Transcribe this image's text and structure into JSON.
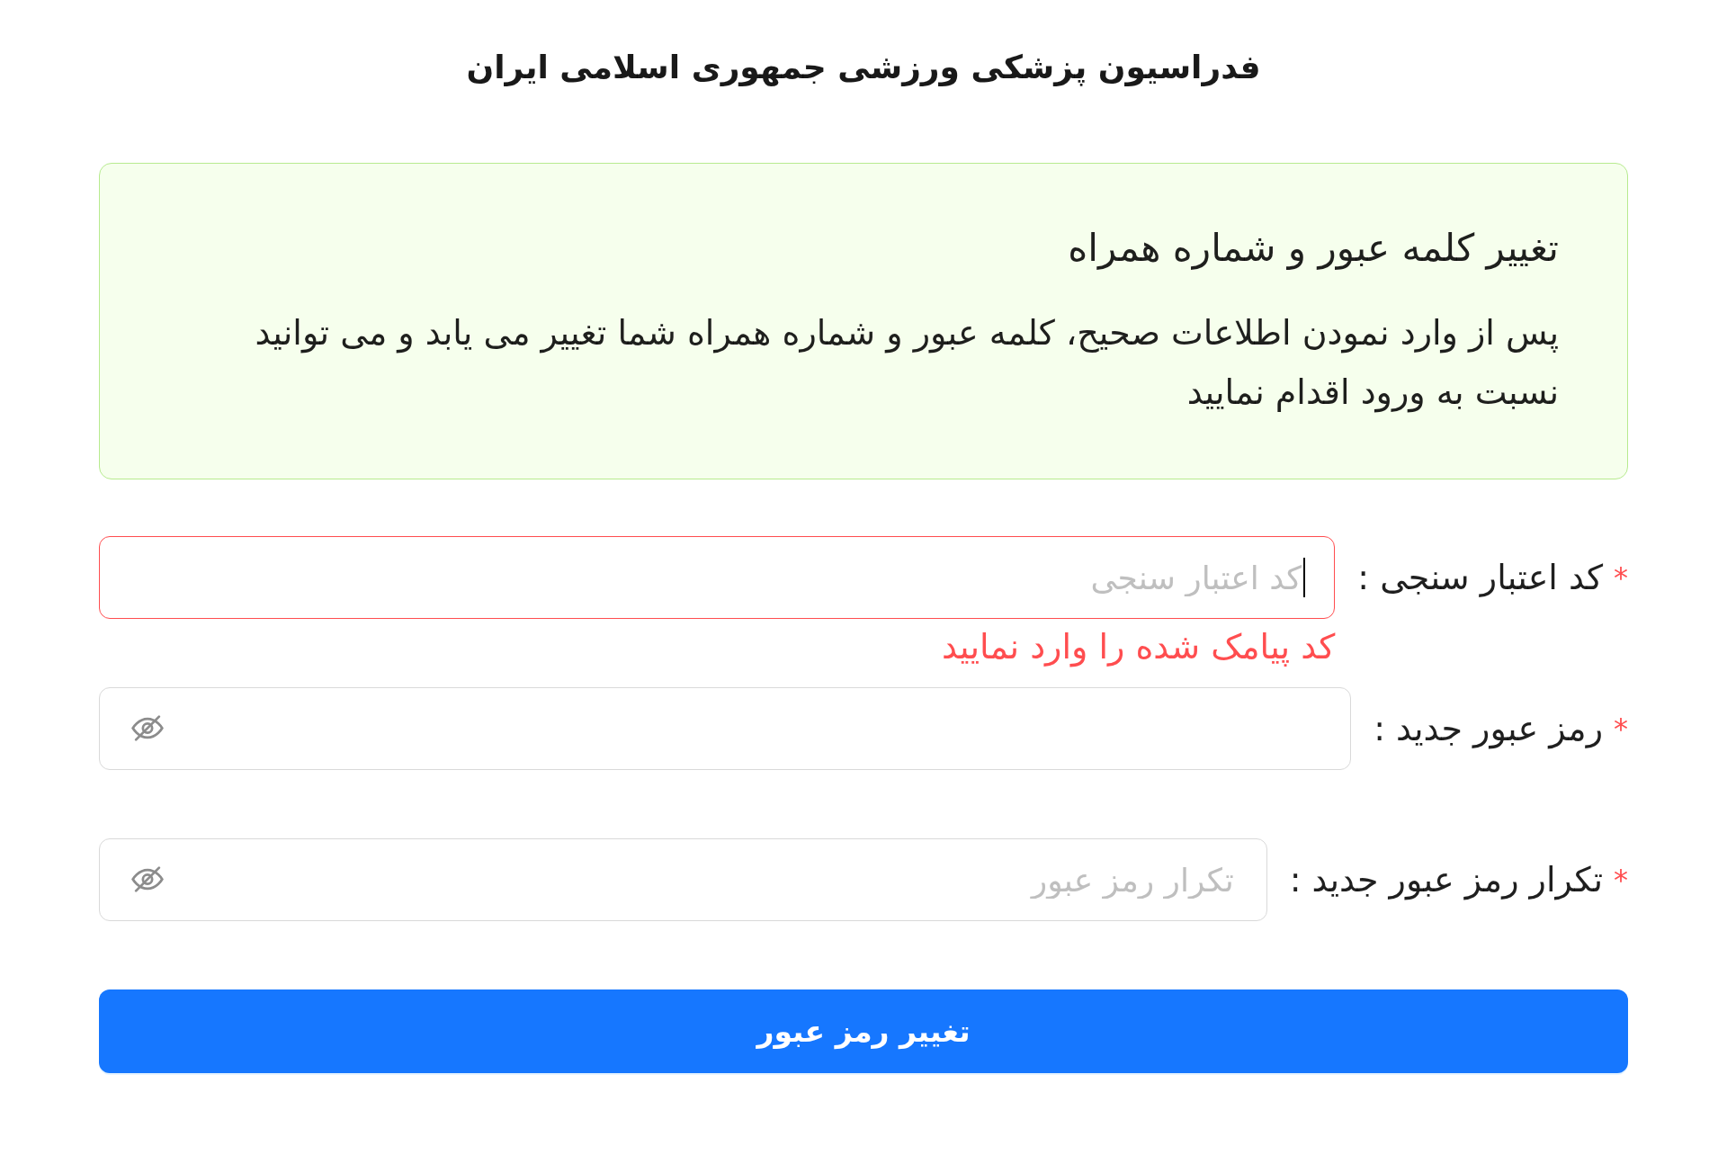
{
  "header": {
    "title": "فدراسیون پزشکی ورزشی جمهوری اسلامی ایران"
  },
  "notice": {
    "title": "تغییر کلمه عبور و شماره همراه",
    "description": "پس از وارد نمودن اطلاعات صحیح، کلمه عبور و شماره همراه شما تغییر می یابد و می توانید نسبت به ورود اقدام نمایید"
  },
  "form": {
    "fields": [
      {
        "kind": "text",
        "required_mark": "*",
        "label": "کد اعتبار سنجی :",
        "placeholder": "کد اعتبار سنجی",
        "focused": true,
        "error": "کد پیامک شده را وارد نمایید"
      },
      {
        "kind": "password",
        "required_mark": "*",
        "label": "رمز عبور جدید :",
        "focused": false
      },
      {
        "kind": "password",
        "required_mark": "*",
        "label": "تکرار رمز عبور جدید :",
        "placeholder": "تکرار رمز عبور",
        "focused": false
      }
    ],
    "submit": {
      "label": "تغییر رمز عبور"
    }
  }
}
